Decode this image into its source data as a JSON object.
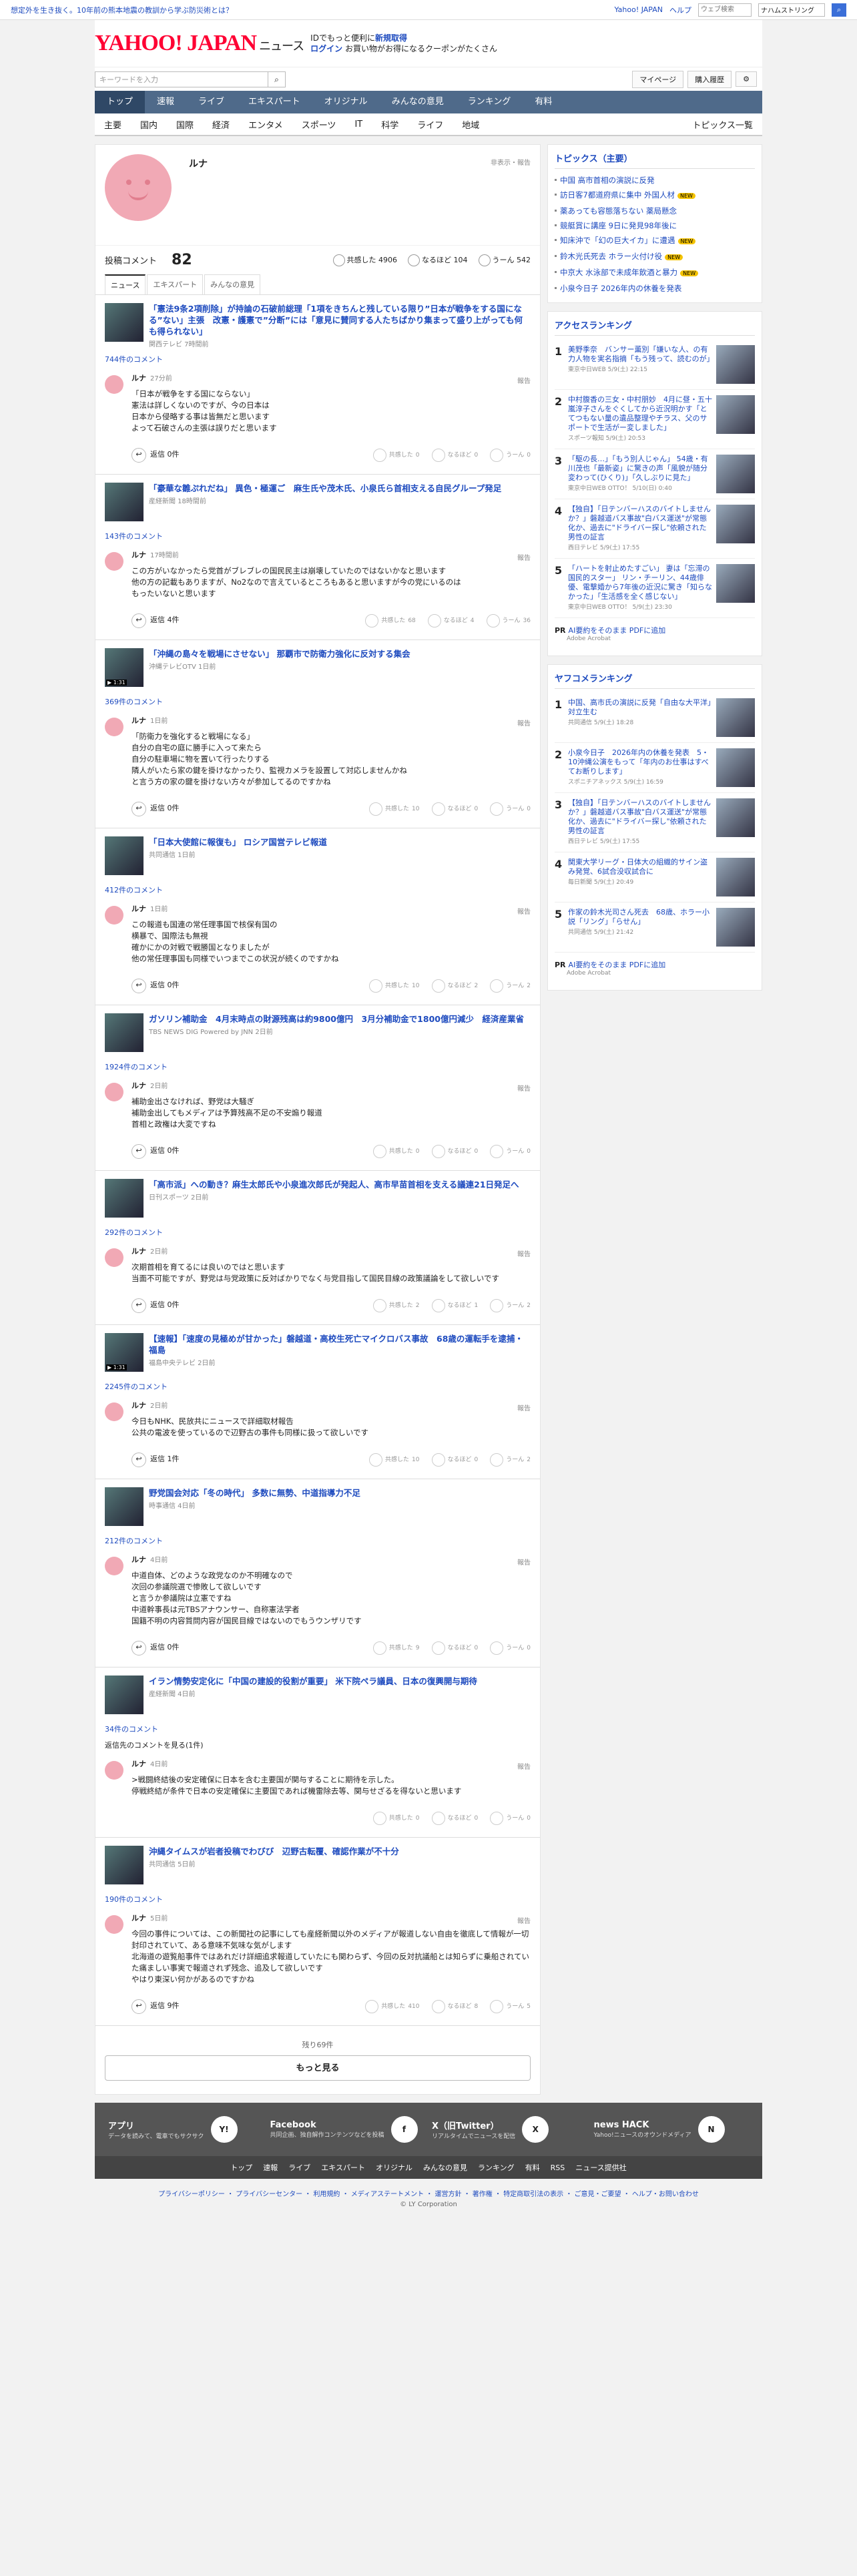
{
  "topbar": {
    "promo": "想定外を生き抜く。10年前の熊本地震の教訓から学ぶ防災術とは？",
    "links": [
      "Yahoo! JAPAN",
      "ヘルプ"
    ],
    "search_placeholder": "ウェブ検索",
    "query": "ナハムストリング"
  },
  "header": {
    "logo": "YAHOO! JAPAN",
    "logo_sub": "ニュース",
    "promo1": "IDでもっと便利に",
    "promo1b": "新規取得",
    "login": "ログイン",
    "promo2": "お買い物がお得になるクーポンがたくさん"
  },
  "search": {
    "placeholder": "キーワードを入力",
    "mypage": "マイページ",
    "history": "購入履歴"
  },
  "nav": [
    "トップ",
    "速報",
    "ライブ",
    "エキスパート",
    "オリジナル",
    "みんなの意見",
    "ランキング",
    "有料"
  ],
  "subnav": [
    "主要",
    "国内",
    "国際",
    "経済",
    "エンタメ",
    "スポーツ",
    "IT",
    "科学",
    "ライフ",
    "地域"
  ],
  "subnav_more": "トピックス一覧",
  "profile": {
    "name": "ルナ",
    "notice": "非表示・報告",
    "label": "投稿コメント",
    "count": "82",
    "reactions": [
      {
        "label": "共感した",
        "n": "4906"
      },
      {
        "label": "なるほど",
        "n": "104"
      },
      {
        "label": "うーん",
        "n": "542"
      }
    ]
  },
  "tabs": [
    "ニュース",
    "エキスパート",
    "みんなの意見"
  ],
  "items": [
    {
      "title": "「憲法9条2項削除」が持論の石破前総理「1項をきちんと残している限り”日本が戦争をする国になる”ない」主張　改憲・護憲で”分断”には「意見に賛同する人たちばかり集まって盛り上がっても何も得られない」",
      "src": "関西テレビ 7時間前",
      "cc": "744件のコメント",
      "time": "27分前",
      "body": "「日本が戦争をする国にならない」\n憲法は詳しくないのですが、今の日本は\n日本から侵略する事は皆無だと思います\nよって石破さんの主張は誤りだと思います",
      "reply": "返信 0件",
      "r": [
        "0",
        "0",
        "0"
      ],
      "v": false
    },
    {
      "title": "「豪華な雛ぷれだね」 異色・極運ご　麻生氏や茂木氏、小泉氏ら首相支える自民グループ発足",
      "src": "産経新聞 18時間前",
      "cc": "143件のコメント",
      "time": "17時間前",
      "body": "この方がいなかったら党首がブレブレの国民民主は崩壊していたのではないかなと思います\n他の方の記載もありますが、No2なので言えているところもあると思いますが今の党にいるのは\nもったいないと思います",
      "reply": "返信 4件",
      "r": [
        "68",
        "4",
        "36"
      ],
      "v": false
    },
    {
      "title": "「沖縄の島々を戦場にさせない」 那覇市で防衛力強化に反対する集会",
      "src": "沖縄テレビOTV 1日前",
      "cc": "369件のコメント",
      "time": "1日前",
      "body": "「防衛力を強化すると戦場になる」\n自分の自宅の庭に勝手に入って来たら\n自分の駐車場に物を置いて行ったりする\n隣人がいたら家の鍵を掛けなかったり、監視カメラを設置して対応しませんかね\nと言う方の家の鍵を掛けない方々が参加してるのですかね",
      "reply": "返信 0件",
      "r": [
        "10",
        "0",
        "0"
      ],
      "v": true
    },
    {
      "title": "「日本大使館に報復も」 ロシア国営テレビ報道",
      "src": "共同通信 1日前",
      "cc": "412件のコメント",
      "time": "1日前",
      "body": "この報道も国連の常任理事国で核保有国の\n横暴で、国際法も無視\n確かにかの対戦で戦勝国となりましたが\n他の常任理事国も同様でいつまでこの状況が続くのですかね",
      "reply": "返信 0件",
      "r": [
        "10",
        "2",
        "2"
      ],
      "v": false
    },
    {
      "title": "ガソリン補助金　4月末時点の財源残高は約9800億円　3月分補助金で1800億円減少　経済産業省",
      "src": "TBS NEWS DIG Powered by JNN 2日前",
      "cc": "1924件のコメント",
      "time": "2日前",
      "body": "補助金出さなければ、野党は大騒ぎ\n補助金出してもメディアは予算残高不足の不安煽り報道\n首相と政権は大変ですね",
      "reply": "返信 0件",
      "r": [
        "0",
        "0",
        "0"
      ],
      "v": false
    },
    {
      "title": "「高市派」への動き？麻生太郎氏や小泉進次郎氏が発起人、高市早苗首相を支える議連21日発足へ",
      "src": "日刊スポーツ 2日前",
      "cc": "292件のコメント",
      "time": "2日前",
      "body": "次期首相を育てるには良いのではと思います\n当面不可能ですが、野党は与党政策に反対ばかりでなく与党目指して国民目線の政策議論をして欲しいです",
      "reply": "返信 0件",
      "r": [
        "2",
        "1",
        "2"
      ],
      "v": false
    },
    {
      "title": "【速報】「速度の見極めが甘かった」磐越道・高校生死亡マイクロバス事故　68歳の運転手を逮捕・福島",
      "src": "福島中央テレビ 2日前",
      "cc": "2245件のコメント",
      "time": "2日前",
      "body": "今日もNHK、民放共にニュースで詳細取材報告\n公共の電波を使っているので辺野古の事件も同様に扱って欲しいです",
      "reply": "返信 1件",
      "r": [
        "10",
        "0",
        "2"
      ],
      "v": true
    },
    {
      "title": "野党国会対応「冬の時代」 多数に無勢、中道指導力不足",
      "src": "時事通信 4日前",
      "cc": "212件のコメント",
      "time": "4日前",
      "body": "中道自体、どのような政党なのか不明確なので\n次回の参議院選で惨敗して欲しいです\nと言うか参議院は立憲ですね\n中道幹事長は元TBSアナウンサー、自称憲法学者\n国籍不明の内容質問内容が国民目線ではないのでもうウンザリです",
      "reply": "返信 0件",
      "r": [
        "9",
        "0",
        "0"
      ],
      "v": false
    },
    {
      "title": "イラン情勢安定化に「中国の建設的役割が重要」 米下院ペラ議員、日本の復興開与期待",
      "src": "産経新聞 4日前",
      "cc": "34件のコメント",
      "time": "4日前",
      "body": ">戦闘終結後の安定確保に日本を含む主要国が関与することに期待を示した。\n停戦終結が条件で日本の安定確保に主要国であれば機雷除去等、関与せざるを得ないと思います",
      "reply": "",
      "r": [
        "0",
        "0",
        "0"
      ],
      "v": false,
      "prev": "返信先のコメントを見る(1件)"
    },
    {
      "title": "沖縄タイムスが岩者投稿でわびび　辺野古転覆、確認作業が不十分",
      "src": "共同通信 5日前",
      "cc": "190件のコメント",
      "time": "5日前",
      "body": "今回の事件については、この新聞社の記事にしても産経新聞以外のメディアが報道しない自由を徹底して情報が一切封印されていて、ある意味不気味な気がします\n北海道の遊覧船事件ではあれだけ詳細追求報道していたにも関わらず、今回の反対抗議船とは知らずに乗船されていた痛ましい事実で報道されず残念、追及して欲しいです\nやはり東深い何かがあるのですかね",
      "reply": "返信 9件",
      "r": [
        "410",
        "8",
        "5"
      ],
      "v": false
    }
  ],
  "more": {
    "remaining": "残り69件",
    "button": "もっと見る"
  },
  "topics": {
    "title": "トピックス（主要）",
    "items": [
      {
        "t": "中国 高市首相の演説に反発",
        "n": ""
      },
      {
        "t": "訪日客7都道府県に集中 外国人材",
        "n": "NEW"
      },
      {
        "t": "薬あっても容態落ちない 薬局懸念",
        "n": ""
      },
      {
        "t": "競艇賞に講座 9日に発見98年後に",
        "n": ""
      },
      {
        "t": "知床沖で「幻の巨大イカ」に遭遇",
        "n": "NEW"
      },
      {
        "t": "鈴木光氏死去 ホラー火付け役",
        "n": "NEW"
      },
      {
        "t": "中京大 水泳部で未成年飲酒と暴力",
        "n": "NEW"
      },
      {
        "t": "小泉今日子 2026年内の休養を発表",
        "n": ""
      }
    ]
  },
  "access": {
    "title": "アクセスランキング",
    "items": [
      {
        "t": "美野季奈　バンサー薫別「嫌いな人、の有力人物を実名指摘「もう残って、読むのが」",
        "s": "東京中日WEB 5/9(土) 22:15"
      },
      {
        "t": "中村腹香の三女・中村朋妙　4月に昼・五十嵐淳子さんをぐくしてから近況明かす「とてつもない量の遺品整理やチラス、父のサポートで生活がー変しました」",
        "s": "スポーツ報知 5/9(土) 20:53"
      },
      {
        "t": "「駆の長…」「もう別人じゃん」 54歳・有川茂也「最新姿」に驚きの声「風貌が随分変わって(ひくり)」「久しぶりに見た」",
        "s": "東京中日WEB OTTO！ 5/10(日) 0:40"
      },
      {
        "t": "【独自】「日テンバーハスのバイトしませんか？」磐越道バス事故\"白バス運送\"が常態化か、過去に\"ドライバー探し\"依頼された男性の証言",
        "s": "西日テレビ 5/9(土) 17:55"
      },
      {
        "t": "「ハートを射止めたすごい」 妻は「忘滞の国民的スター」 リン・チーリン、44歳俳優、電撃婚から7年後の近況に驚き「知らなかった」「生活感を全く感じない」",
        "s": "東京中日WEB OTTO！ 5/9(土) 23:30"
      }
    ]
  },
  "pr1": {
    "label": "PR",
    "text": "AI要約をそのまま PDFに追加",
    "src": "Adobe Acrobat"
  },
  "yafoo": {
    "title": "ヤフコメランキング",
    "items": [
      {
        "t": "中国、高市氏の演説に反発「自由な大平洋」対立生む",
        "s": "共同通信 5/9(土) 18:28"
      },
      {
        "t": "小泉今日子　2026年内の休養を発表　5・10沖縄公演をもって「年内のお仕事はすべてお断りします」",
        "s": "スポニチアネックス 5/9(土) 16:59"
      },
      {
        "t": "【独自】「日テンバーハスのバイトしませんか？」磐越道バス事故\"白バス運送\"が常態化か、過去に\"ドライバー探し\"依頼された男性の証言",
        "s": "西日テレビ 5/9(土) 17:55"
      },
      {
        "t": "関東大学リーグ・日体大の組織的サイン盗み発覚、6試合没収試合に",
        "s": "毎日新聞 5/9(土) 20:49"
      },
      {
        "t": "作家の鈴木光司さん死去　68歳、ホラー小説「リング」「らせん」",
        "s": "共同通信 5/9(土) 21:42"
      }
    ]
  },
  "pr2": {
    "label": "PR",
    "text": "AI要約をそのまま PDFに追加",
    "src": "Adobe Acrobat"
  },
  "footer": {
    "cards": [
      {
        "t": "アプリ",
        "d": "データを読みて、電車でもサクサク",
        "ic": "Y!"
      },
      {
        "t": "Facebook",
        "d": "共同企画、独自解作コンテンツなどを投稿",
        "ic": "f"
      },
      {
        "t": "X（旧Twitter）",
        "d": "リアルタイムでニュースを配信",
        "ic": "X"
      },
      {
        "t": "news HACK",
        "d": "Yahoo!ニュースのオウンドメディア",
        "ic": "N"
      }
    ],
    "nav": [
      "トップ",
      "速報",
      "ライブ",
      "エキスパート",
      "オリジナル",
      "みんなの意見",
      "ランキング",
      "有料",
      "RSS",
      "ニュース提供社"
    ],
    "links": "プライバシーポリシー ・ プライバシーセンター ・ 利用規約 ・ メディアステートメント ・ 運営方針 ・ 著作権 ・ 特定商取引法の表示 ・ ご意見・ご要望 ・ ヘルプ・お問い合わせ",
    "copy": "© LY Corporation"
  }
}
